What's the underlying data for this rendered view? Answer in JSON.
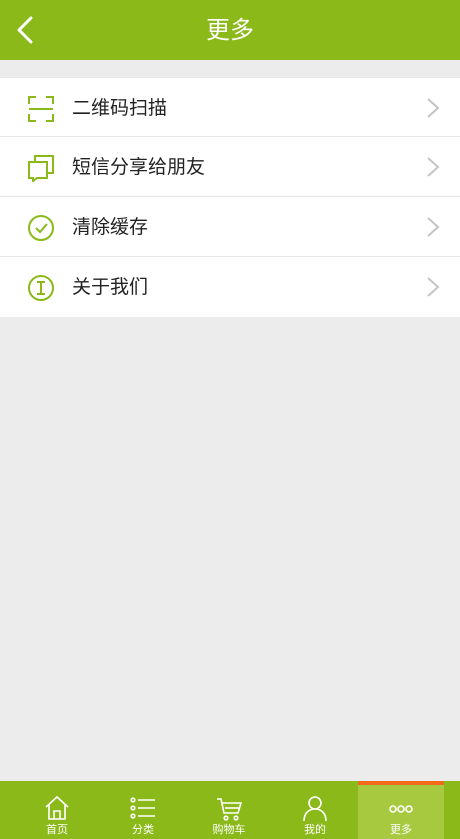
{
  "header": {
    "title": "更多"
  },
  "menu": [
    {
      "label": "二维码扫描",
      "icon": "qr-scan-icon"
    },
    {
      "label": "短信分享给朋友",
      "icon": "share-icon"
    },
    {
      "label": "清除缓存",
      "icon": "check-circle-icon"
    },
    {
      "label": "关于我们",
      "icon": "info-icon"
    }
  ],
  "tabs": [
    {
      "label": "首页",
      "icon": "home-icon"
    },
    {
      "label": "分类",
      "icon": "list-icon"
    },
    {
      "label": "购物车",
      "icon": "cart-icon"
    },
    {
      "label": "我的",
      "icon": "user-icon"
    },
    {
      "label": "更多",
      "icon": "more-icon",
      "active": true
    }
  ],
  "colors": {
    "brand": "#8ab919",
    "accent": "#f26b1d",
    "background": "#ececec"
  }
}
